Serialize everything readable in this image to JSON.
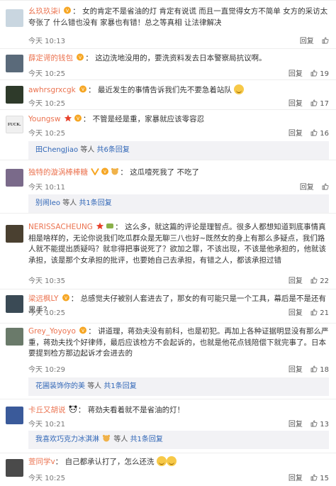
{
  "comments": [
    {
      "id": 1,
      "user": "幺玖玖柒i",
      "text": "女的肯定不是省油的灯 肯定有说谎 而且一直觉得女方不简单 女方的采访太夸张了 什么错也没有 家暴也有错！总之等真相 让法律解决",
      "time": "今天 10:13",
      "reply": "回复",
      "likes": "",
      "avatar_color": "#c9d6e0",
      "badges": [
        "vip"
      ]
    },
    {
      "id": 2,
      "user": "薛定谔的钱包",
      "text": "这边洗地没用的，要洗资料发去日本警察局抗议啊。",
      "time": "今天 10:25",
      "reply": "回复",
      "likes": "19",
      "avatar_color": "#5a6a7a",
      "badges": [
        "vip"
      ]
    },
    {
      "id": 3,
      "user": "awhrsgrxcgk",
      "text": "最近发生的事情告诉我们先不要急着站队",
      "time": "今天 10:25",
      "reply": "回复",
      "likes": "17",
      "avatar_color": "#2e3a2a",
      "badges": [
        "vip"
      ],
      "emoji": true
    },
    {
      "id": 4,
      "user": "Youngsw",
      "text": "不管是经是重，家暴就应该零容忍",
      "time": "今天 10:25",
      "reply": "回复",
      "likes": "16",
      "avatar_color": "#f0f0f0",
      "avatar_text": "FUCK.",
      "badges": [
        "star",
        "vip"
      ],
      "replies": {
        "who": "田ChengJiao",
        "mid": "等人",
        "count": "共6条回复"
      }
    },
    {
      "id": 5,
      "user": "独特的漩涡棒棒糖",
      "text": "这瓜噎死我了 不吃了",
      "time": "今天 10:11",
      "reply": "回复",
      "likes": "",
      "avatar_color": "#7a6a8a",
      "badges": [
        "v",
        "vip",
        "vip2"
      ],
      "replies": {
        "who": "别闹leo",
        "mid": "等人",
        "count": "共1条回复"
      }
    },
    {
      "id": 6,
      "user": "NERISSACHEUNG",
      "text": "这么多，就这篇的评论是理智点。很多人都想知道到底事情真相是啥样的，无论你说我们吃瓜群众是无聊三八也好~既然女的身上有那么多疑点，我们路人就不能提出质疑吗？就非得把事说死了？欲加之罪，不该出现，不该是他承担的，他就该承担，该是那个女承担的批评，也要她自己去承担，有错之人，都该承担过错",
      "time": "今天 10:35",
      "reply": "回复",
      "likes": "22",
      "avatar_color": "#4a4030",
      "badges": [
        "star",
        "vip3"
      ]
    },
    {
      "id": 7,
      "user": "梁远枫LY",
      "text": "总感觉夫仔被别人套进去了，那女的有可能只是一个工具，幕后是不是还有黑手？",
      "time": "今天 10:25",
      "reply": "回复",
      "likes": "21",
      "avatar_color": "#3a4a55",
      "badges": [
        "vip"
      ]
    },
    {
      "id": 8,
      "user": "Grey_Yoyoyo",
      "text": "讲道理，蒋劲夫没有前科，也是初犯。再加上各种证据明显没有那么严重，蒋劲夫找个好律师，最后应该检方不会起诉的，也就是他花点钱陪偿下就完事了。日本要提到检方那边起诉才会进去的",
      "time": "今天 10:29",
      "reply": "回复",
      "likes": "18",
      "avatar_color": "#6a7a6a",
      "badges": [
        "vip"
      ],
      "replies": {
        "who": "花圃装饰你的美",
        "mid": "等人",
        "count": "共1条回复"
      }
    },
    {
      "id": 9,
      "user": "卡丘又胡说",
      "text": "蒋劲夫看着就不是省油的灯！",
      "time": "今天 10:21",
      "reply": "回复",
      "likes": "13",
      "avatar_color": "#3a5a9a",
      "badges": [
        "panda"
      ],
      "replies": {
        "who": "我喜欢巧克力冰淇淋",
        "mid": "等人",
        "count": "共1条回复"
      }
    },
    {
      "id": 10,
      "user": "萱同学v",
      "text": "自己都承认打了，怎么还洗",
      "time": "今天 10:25",
      "reply": "回复",
      "likes": "15",
      "avatar_color": "#4a4a4a",
      "badges": [],
      "emoji2": true
    }
  ]
}
